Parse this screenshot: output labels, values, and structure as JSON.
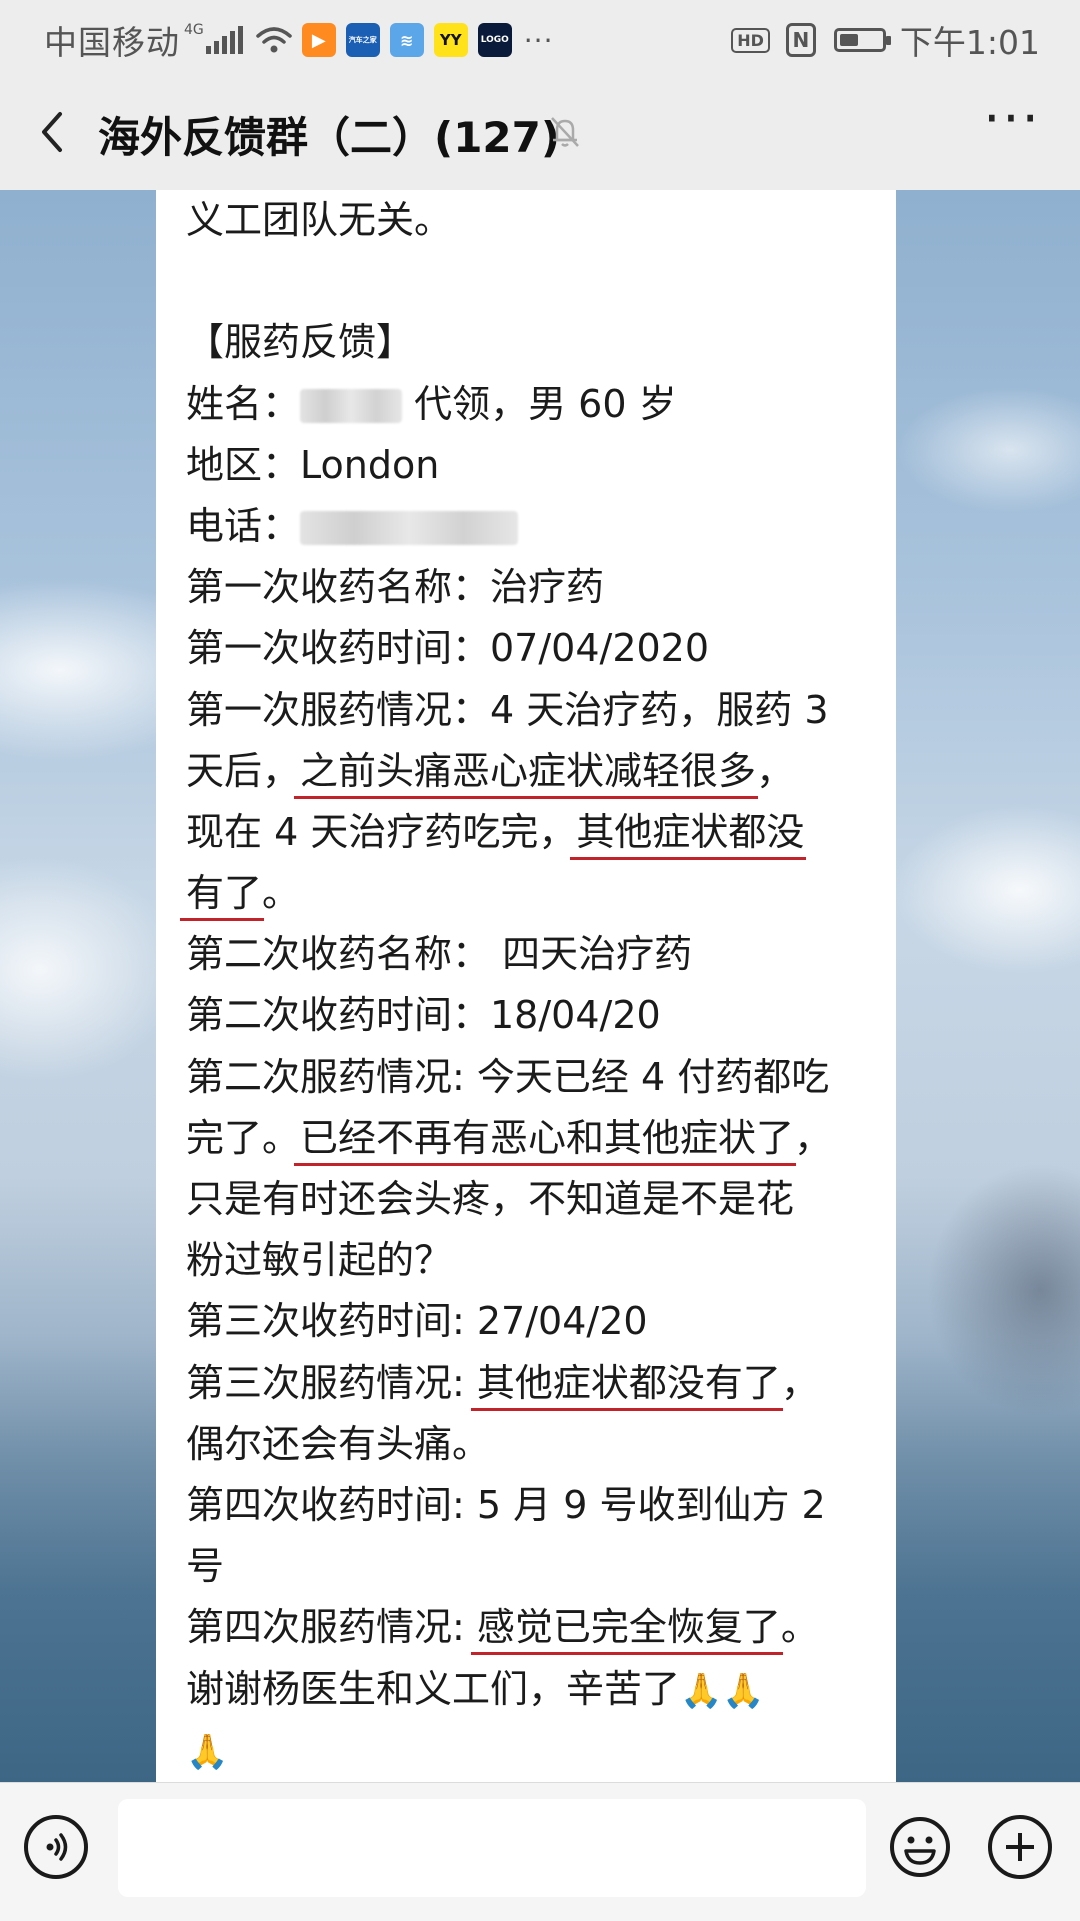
{
  "status_bar": {
    "carrier": "中国移动",
    "network": "4G",
    "app_icons": [
      {
        "name": "play-app-icon",
        "glyph": "▶"
      },
      {
        "name": "car-app-icon",
        "glyph": "汽车之家"
      },
      {
        "name": "fish-app-icon",
        "glyph": "≋"
      },
      {
        "name": "yy-app-icon",
        "glyph": "YY"
      },
      {
        "name": "logo-app-icon",
        "glyph": "LOGO"
      }
    ],
    "more_dots": "···",
    "hd": "HD",
    "nfc": "N",
    "battery_level": 0.45,
    "time": "下午1:01"
  },
  "header": {
    "title": "海外反馈群（二）(127)"
  },
  "message": {
    "lines": [
      {
        "segments": [
          {
            "text": "义工团队无关。"
          }
        ]
      },
      {
        "blank": true
      },
      {
        "segments": [
          {
            "text": "【服药反馈】"
          }
        ]
      },
      {
        "segments": [
          {
            "text": "姓名："
          },
          {
            "blur": "name",
            "width": 102
          },
          {
            "text": " 代领，男 60 岁"
          }
        ]
      },
      {
        "segments": [
          {
            "text": "地区：London"
          }
        ]
      },
      {
        "segments": [
          {
            "text": "电话："
          },
          {
            "blur": "phone",
            "width": 218
          }
        ]
      },
      {
        "segments": [
          {
            "text": "第一次收药名称：治疗药"
          }
        ]
      },
      {
        "segments": [
          {
            "text": "第一次收药时间：07/04/2020"
          }
        ]
      },
      {
        "segments": [
          {
            "text": "第一次服药情况：4 天治疗药，服药 3"
          }
        ]
      },
      {
        "segments": [
          {
            "text": "天后，"
          },
          {
            "text": "之前头痛恶心症状减轻很多",
            "u": true
          },
          {
            "text": "，"
          }
        ]
      },
      {
        "segments": [
          {
            "text": "现在 4 天治疗药吃完，"
          },
          {
            "text": "其他症状都没",
            "u": true
          }
        ]
      },
      {
        "segments": [
          {
            "text": "有了",
            "u": true
          },
          {
            "text": "。"
          }
        ]
      },
      {
        "segments": [
          {
            "text": "第二次收药名称： 四天治疗药"
          }
        ]
      },
      {
        "segments": [
          {
            "text": "第二次收药时间：18/04/20"
          }
        ]
      },
      {
        "segments": [
          {
            "text": "第二次服药情况: 今天已经 4 付药都吃"
          }
        ]
      },
      {
        "segments": [
          {
            "text": "完了。"
          },
          {
            "text": "已经不再有恶心和其他症状了",
            "u": true
          },
          {
            "text": "，"
          }
        ]
      },
      {
        "segments": [
          {
            "text": "只是有时还会头疼，不知道是不是花"
          }
        ]
      },
      {
        "segments": [
          {
            "text": "粉过敏引起的？"
          }
        ]
      },
      {
        "segments": [
          {
            "text": "第三次收药时间: 27/04/20"
          }
        ]
      },
      {
        "segments": [
          {
            "text": "第三次服药情况: "
          },
          {
            "text": "其他症状都没有了",
            "u": true
          },
          {
            "text": "，"
          }
        ]
      },
      {
        "segments": [
          {
            "text": "偶尔还会有头痛。"
          }
        ]
      },
      {
        "segments": [
          {
            "text": "第四次收药时间: 5 月 9 号收到仙方 2"
          }
        ]
      },
      {
        "segments": [
          {
            "text": "号"
          }
        ]
      },
      {
        "segments": [
          {
            "text": "第四次服药情况: "
          },
          {
            "text": "感觉已完全恢复了",
            "u": true
          },
          {
            "text": "。"
          }
        ]
      },
      {
        "segments": [
          {
            "text": "谢谢杨医生和义工们，辛苦了"
          },
          {
            "emoji": "🙏"
          },
          {
            "emoji": "🙏"
          }
        ]
      },
      {
        "segments": [
          {
            "emoji": "🙏"
          }
        ]
      }
    ]
  },
  "input_bar": {
    "placeholder": ""
  }
}
